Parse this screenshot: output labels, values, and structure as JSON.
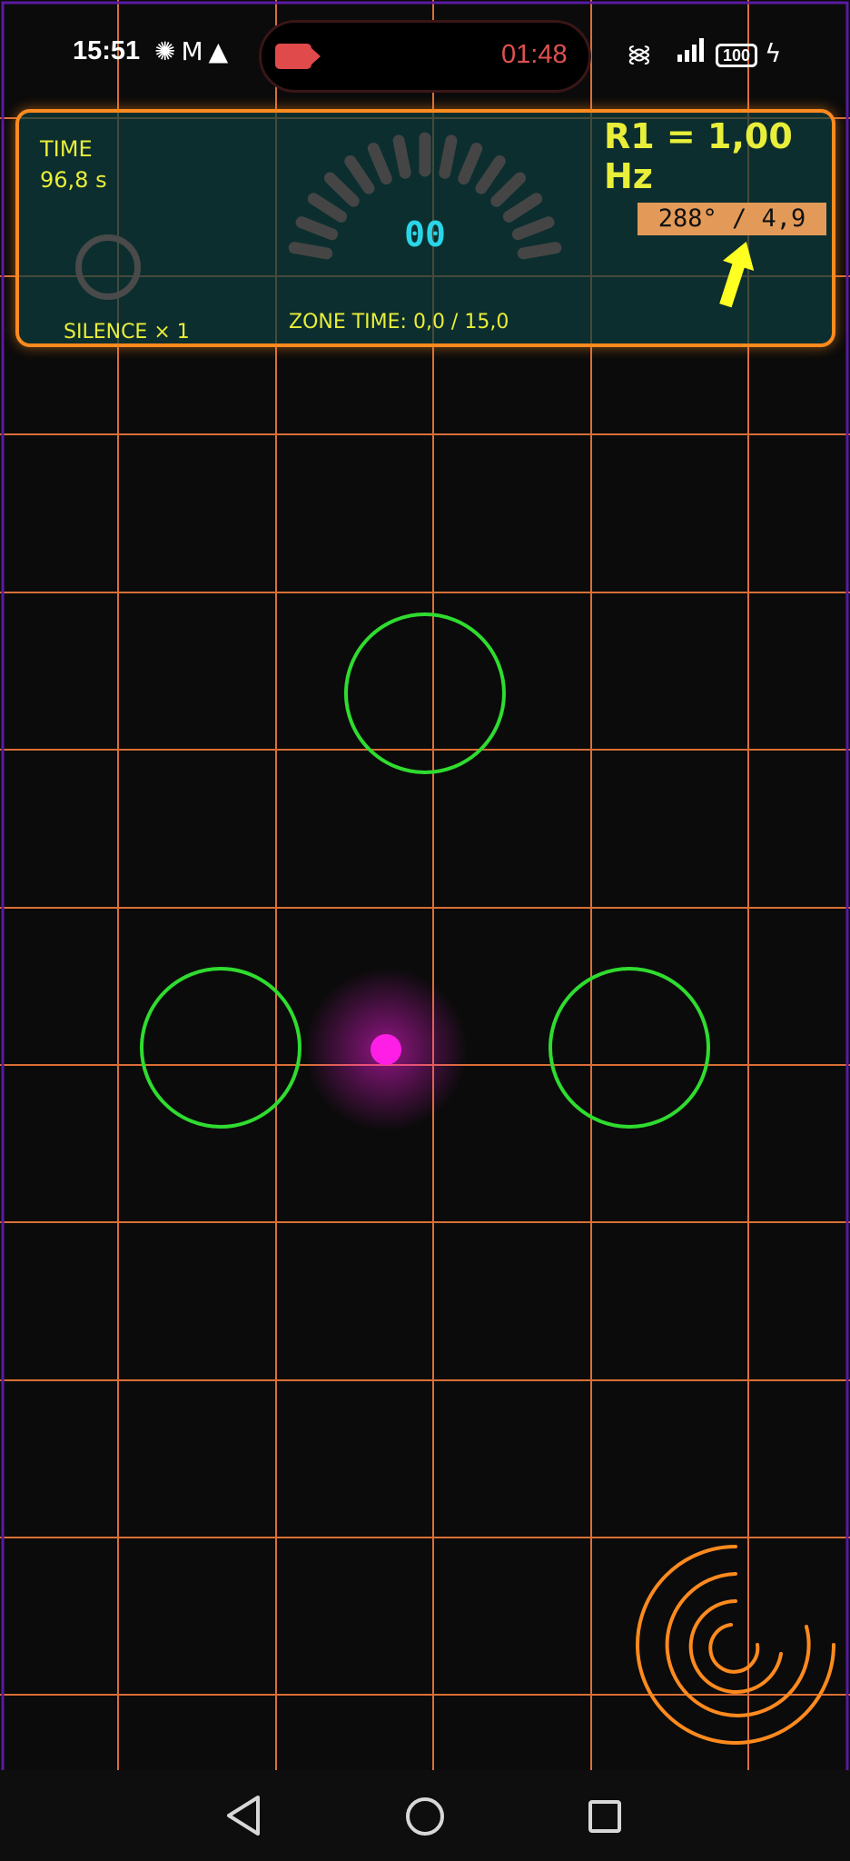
{
  "status_bar": {
    "time": "15:51",
    "notification_icons": [
      "openai-icon",
      "gmail-icon",
      "warning-icon"
    ],
    "recording_time": "01:48",
    "battery": "100",
    "status_icons": [
      "wifi-6-icon",
      "signal-icon",
      "battery-icon",
      "charging-icon"
    ]
  },
  "hud": {
    "time_label": "TIME",
    "time_value": "96,8 s",
    "silence": "SILENCE × 1",
    "zone_time": "ZONE TIME: 0,0 / 15,0",
    "frequency": "R1 = 1,00 Hz",
    "bearing": "288° / 4,9",
    "gauge_value": "00",
    "gauge_level": 0
  },
  "colors": {
    "accent_orange": "#ff8a1e",
    "hud_text": "#e9ee3a",
    "gauge_text": "#29d5e6",
    "target_green": "#2fdc2f",
    "player_magenta": "#ff1ee6",
    "grid": "#f07a3c",
    "arrow_yellow": "#ffff22"
  },
  "icons": {
    "arrow": "arrow-up-icon",
    "radar": "radar-spiral-icon",
    "nav": [
      "back-icon",
      "home-icon",
      "recents-icon"
    ]
  }
}
